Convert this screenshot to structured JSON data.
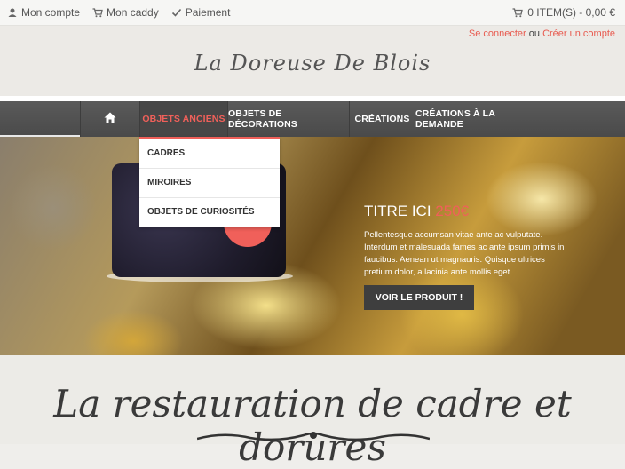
{
  "topbar": {
    "account": "Mon compte",
    "cart": "Mon caddy",
    "payment": "Paiement",
    "cart_summary": "0 ITEM(S) - 0,00 €"
  },
  "auth": {
    "login": "Se connecter",
    "or": "ou",
    "register": "Créer un compte"
  },
  "logo": "La Doreuse De Blois",
  "nav": {
    "items": [
      "Objets anciens",
      "Objets de décorations",
      "Créations",
      "Créations à la demande"
    ],
    "dropdown": [
      "Cadres",
      "Miroires",
      "Objets de curiosités"
    ]
  },
  "hero": {
    "title": "TITRE ICI",
    "price": "250€",
    "description": "Pellentesque accumsan vitae ante ac vulputate. Interdum et malesuada fames ac ante ipsum primis in faucibus. Aenean ut magnauris. Quisque ultrices pretium dolor, a lacinia ante mollis eget.",
    "button": "Voir le produit !"
  },
  "banner_title": "La restauration de cadre et dorures",
  "colors": {
    "accent": "#f0605a",
    "nav": "#4f4f4f"
  },
  "icons": [
    "user-icon",
    "cart-icon",
    "check-icon",
    "home-icon"
  ]
}
